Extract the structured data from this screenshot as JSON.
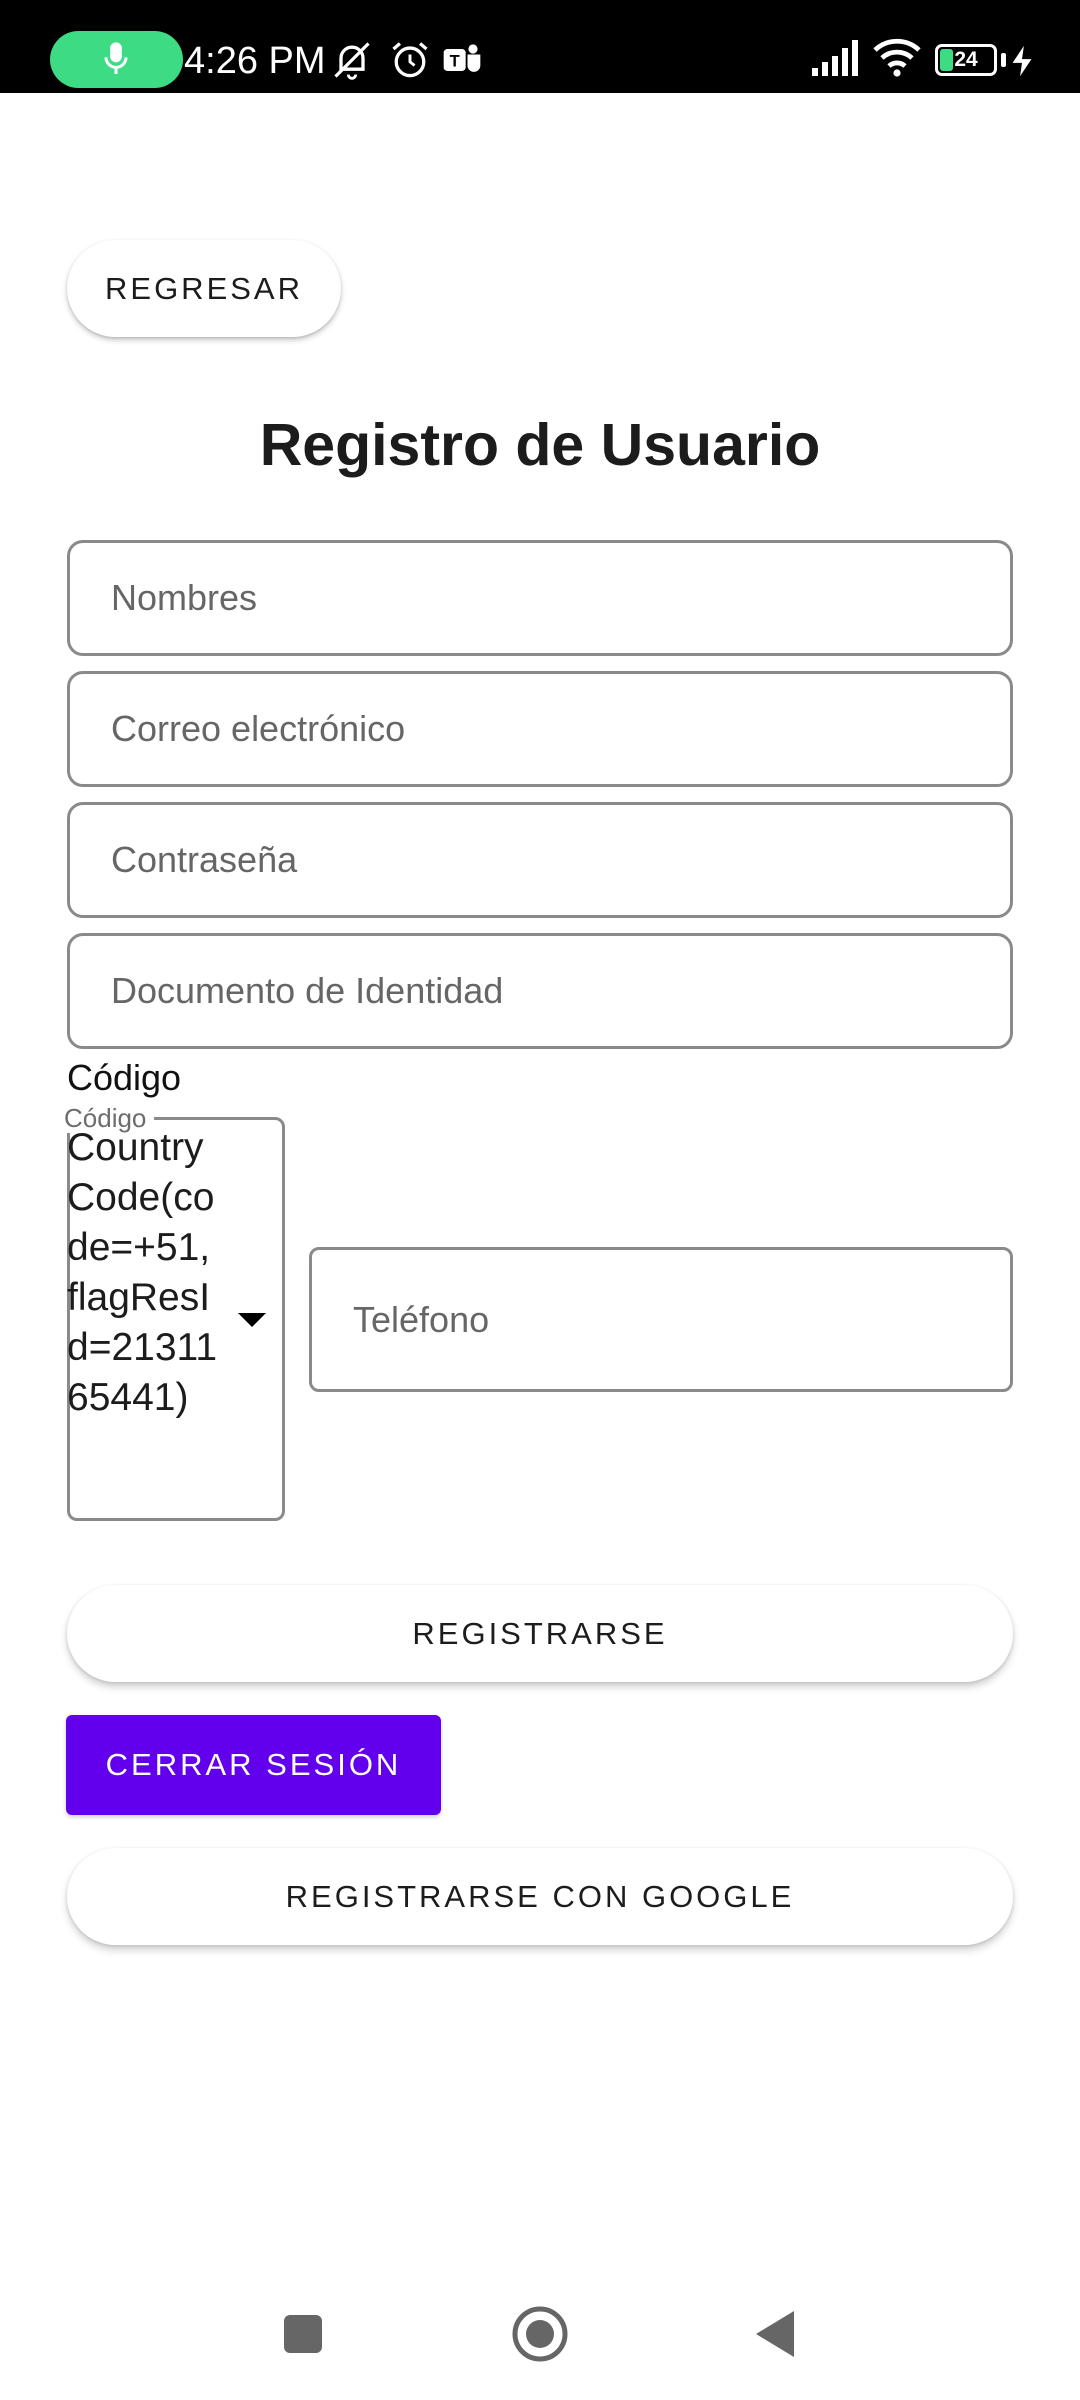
{
  "status_bar": {
    "time": "4:26 PM",
    "battery_level": "24",
    "icons": [
      "microphone-icon",
      "muted-notifications-icon",
      "alarm-icon",
      "teams-icon",
      "signal-icon",
      "wifi-icon",
      "battery-icon",
      "charging-icon"
    ],
    "mic_color": "#3ddc84"
  },
  "header": {
    "back_label": "REGRESAR",
    "title": "Registro de Usuario"
  },
  "form": {
    "names_placeholder": "Nombres",
    "email_placeholder": "Correo electrónico",
    "password_placeholder": "Contraseña",
    "id_document_placeholder": "Documento de Identidad",
    "code_label": "Código",
    "code_floating_label": "Código",
    "code_value": "CountryCode(code=+51, flagResId=2131165441)",
    "phone_placeholder": "Teléfono"
  },
  "actions": {
    "register_label": "REGISTRARSE",
    "logout_label": "CERRAR SESIÓN",
    "google_label": "REGISTRARSE CON GOOGLE"
  },
  "colors": {
    "accent": "#6200ee"
  },
  "nav_bar": {
    "icons": [
      "recents-icon",
      "home-icon",
      "back-icon"
    ]
  }
}
